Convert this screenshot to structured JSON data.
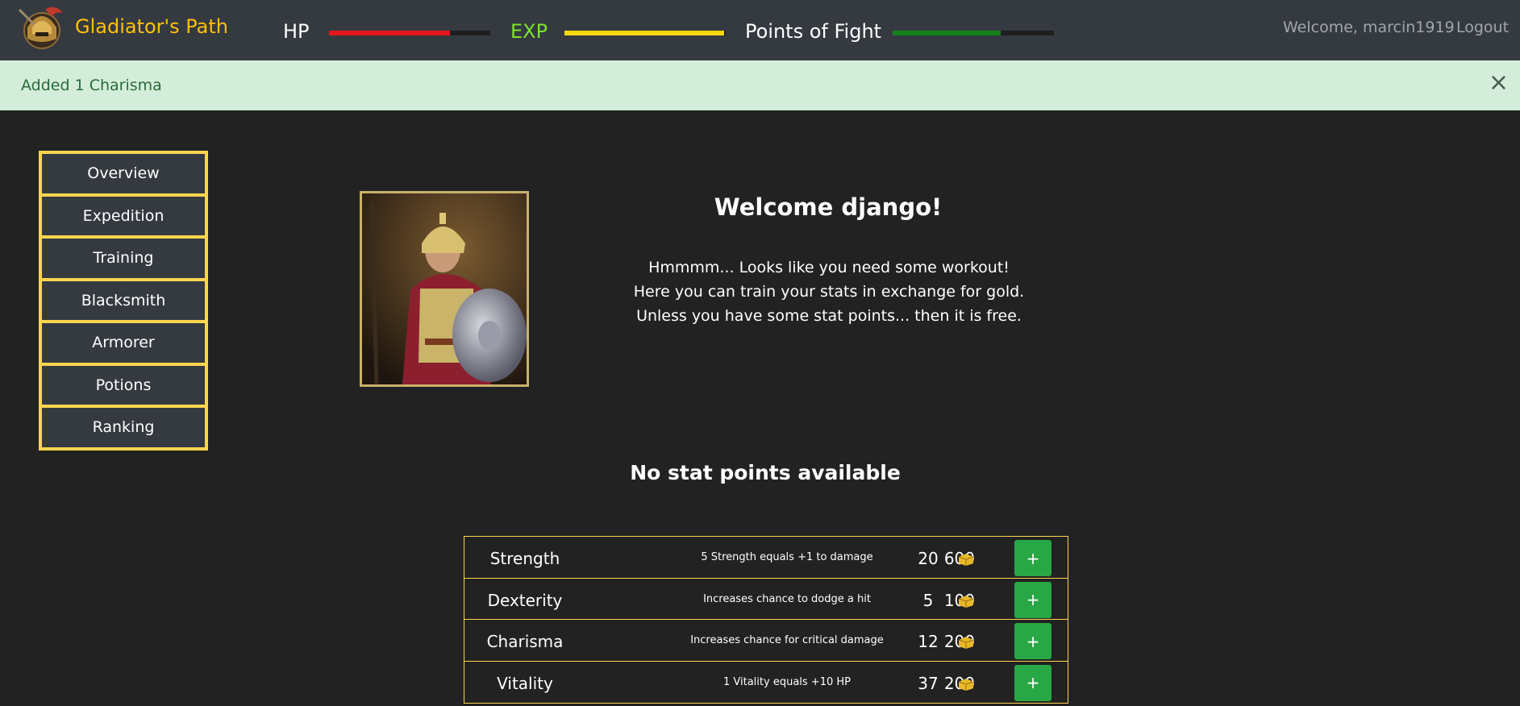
{
  "navbar": {
    "brand": "Gladiator's Path",
    "hp_label": "HP",
    "hp_fill": 0.75,
    "hp_color": "#e4161d",
    "exp_label": "EXP",
    "exp_fill": 0.99,
    "exp_color": "#f5d90a",
    "exp_label_color": "#7fe32a",
    "pof_label": "Points of Fight",
    "pof_fill": 0.67,
    "pof_color": "#15801a",
    "welcome": "Welcome, marcin1919",
    "logout": "Logout",
    "icons": {
      "logo": "gladiator-helmet-icon"
    }
  },
  "alert": {
    "text": "Added 1 Charisma",
    "close": "×",
    "bg_color": "#d4edda"
  },
  "sidebar": {
    "items": [
      {
        "label": "Overview"
      },
      {
        "label": "Expedition"
      },
      {
        "label": "Training"
      },
      {
        "label": "Blacksmith"
      },
      {
        "label": "Armorer"
      },
      {
        "label": "Potions"
      },
      {
        "label": "Ranking"
      }
    ],
    "border_color": "#ffd54f"
  },
  "main": {
    "title": "Welcome django!",
    "lines": [
      "Hmmmm... Looks like you need some workout!",
      "Here you can train your stats in exchange for gold.",
      "Unless you have some stat points... then it is free."
    ],
    "no_points": "No stat points available"
  },
  "stats": [
    {
      "name": "Strength",
      "desc": "5 Strength equals +1 to damage",
      "value": "20",
      "cost": "600",
      "button": "+"
    },
    {
      "name": "Dexterity",
      "desc": "Increases chance to dodge a hit",
      "value": "5",
      "cost": "100",
      "button": "+"
    },
    {
      "name": "Charisma",
      "desc": "Increases chance for critical damage",
      "value": "12",
      "cost": "200",
      "button": "+"
    },
    {
      "name": "Vitality",
      "desc": "1 Vitality equals +10 HP",
      "value": "37",
      "cost": "200",
      "button": "+"
    }
  ],
  "colors": {
    "accent": "#ffc107",
    "button_green": "#28a745",
    "navbar_bg": "#343a40",
    "page_bg": "#222222"
  }
}
